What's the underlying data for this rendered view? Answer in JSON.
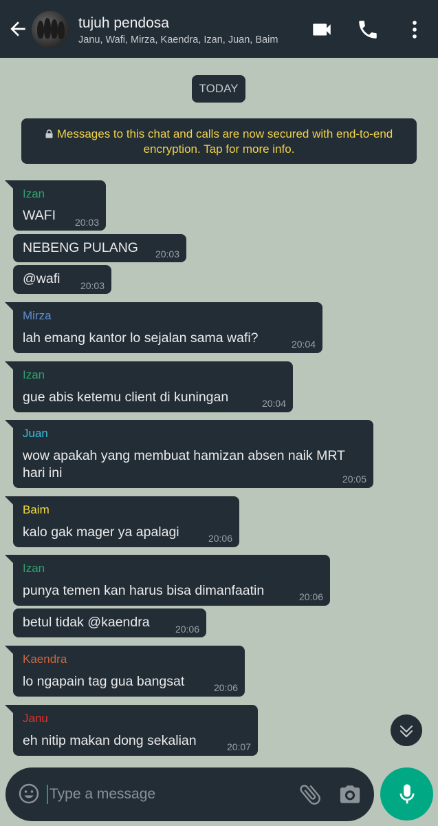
{
  "header": {
    "title": "tujuh pendosa",
    "subtitle": "Janu, Wafi, Mirza, Kaendra, Izan, Juan, Baim"
  },
  "colors": {
    "bubble": "#232d36",
    "background": "#b9c6b9",
    "accent": "#00a884",
    "encryption_text": "#f1d34b"
  },
  "date_divider": "TODAY",
  "encryption_notice": "Messages to this chat and calls are now secured with end-to-end encryption. Tap for more info.",
  "messages": [
    {
      "sender": "Izan",
      "sender_color": "#2fa36b",
      "text": "WAFI",
      "time": "20:03"
    },
    {
      "sender": "",
      "text": "NEBENG PULANG",
      "time": "20:03"
    },
    {
      "sender": "",
      "text": "@wafi",
      "time": "20:03"
    },
    {
      "sender": "Mirza",
      "sender_color": "#5f8fd0",
      "text": "lah emang kantor lo sejalan sama wafi?",
      "time": "20:04"
    },
    {
      "sender": "Izan",
      "sender_color": "#2fa36b",
      "text": "gue abis ketemu client di kuningan",
      "time": "20:04"
    },
    {
      "sender": "Juan",
      "sender_color": "#3bc1dc",
      "text_line1": "wow apakah yang membuat hamizan absen naik MRT",
      "text_line2": "hari ini",
      "time": "20:05"
    },
    {
      "sender": "Baim",
      "sender_color": "#f2dc3c",
      "text": "kalo gak mager ya apalagi",
      "time": "20:06"
    },
    {
      "sender": "Izan",
      "sender_color": "#2fa36b",
      "text": "punya temen kan harus bisa dimanfaatin",
      "time": "20:06"
    },
    {
      "sender": "",
      "text": "betul tidak @kaendra",
      "time": "20:06"
    },
    {
      "sender": "Kaendra",
      "sender_color": "#d0653e",
      "text": "lo ngapain tag gua bangsat",
      "time": "20:06"
    },
    {
      "sender": "Janu",
      "sender_color": "#e5312b",
      "text": "eh nitip makan dong sekalian",
      "time": "20:07"
    }
  ],
  "composer": {
    "placeholder": "Type a message",
    "value": ""
  },
  "icons": [
    "back-arrow-icon",
    "video-call-icon",
    "voice-call-icon",
    "more-options-icon",
    "lock-icon",
    "scroll-down-icon",
    "emoji-icon",
    "attach-icon",
    "camera-icon",
    "microphone-icon"
  ]
}
